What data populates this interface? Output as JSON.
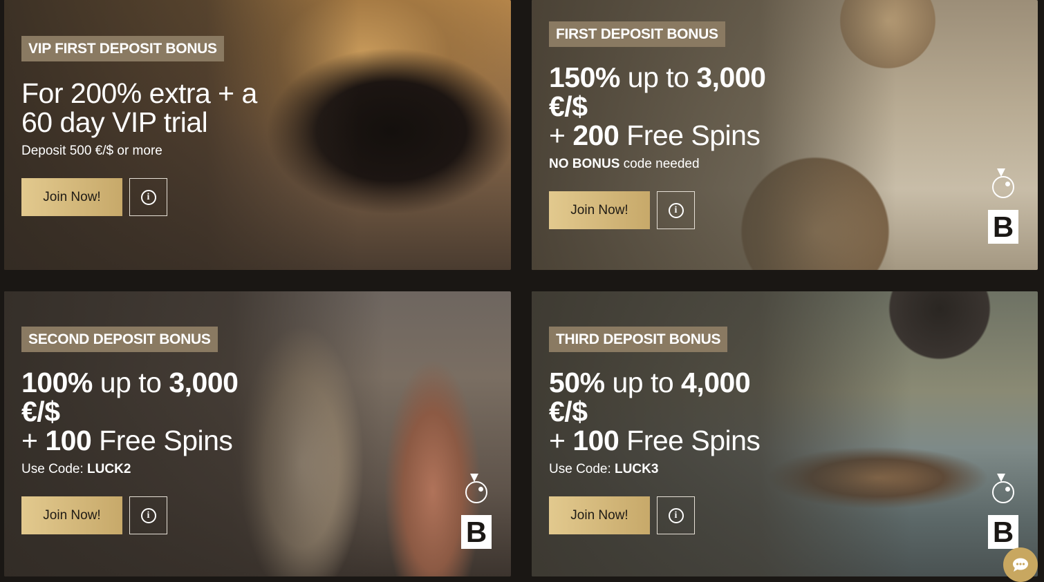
{
  "cards": [
    {
      "badge": "VIP FIRST DEPOSIT BONUS",
      "headline_lines": [
        "For 200% extra + a",
        "60 day VIP trial"
      ],
      "sub": "Deposit 500 €/$ or more",
      "join_label": "Join Now!"
    },
    {
      "badge": "FIRST DEPOSIT BONUS",
      "percent": "150%",
      "up_to": " up to ",
      "amount": "3,000",
      "currency": "€/$",
      "spins_plus": "+ ",
      "spins_count": "200",
      "spins_label": " Free Spins",
      "sub_bold": "NO BONUS",
      "sub_rest": " code needed",
      "join_label": "Join Now!"
    },
    {
      "badge": "SECOND DEPOSIT BONUS",
      "percent": "100%",
      "up_to": " up to ",
      "amount": "3,000",
      "currency": "€/$",
      "spins_plus": "+ ",
      "spins_count": "100",
      "spins_label": " Free Spins",
      "sub_rest": "Use Code: ",
      "sub_bold": "LUCK2",
      "join_label": "Join Now!"
    },
    {
      "badge": "THIRD DEPOSIT BONUS",
      "percent": "50%",
      "up_to": " up to ",
      "amount": "4,000",
      "currency": "€/$",
      "spins_plus": "+ ",
      "spins_count": "100",
      "spins_label": " Free Spins",
      "sub_rest": "Use Code: ",
      "sub_bold": "LUCK3",
      "join_label": "Join Now!"
    }
  ],
  "info_glyph": "i",
  "logo_letter": "B",
  "icons": {
    "info": "info-icon",
    "logo": "brand-logo-icon",
    "chat": "chat-icon"
  },
  "colors": {
    "background": "#1a1714",
    "badge": "#8a7a62",
    "join_button_start": "#e2c98e",
    "join_button_end": "#c7a96a",
    "chat_button": "#c8a760"
  }
}
